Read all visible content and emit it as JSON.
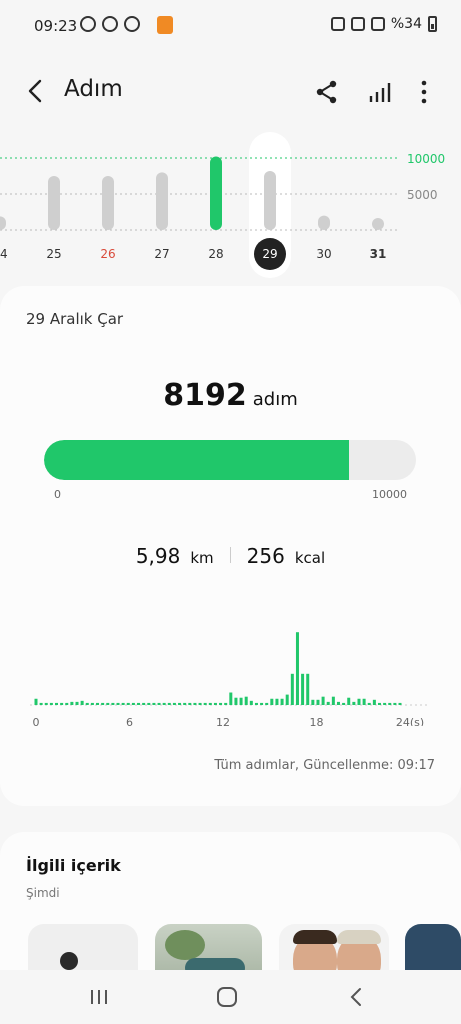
{
  "status": {
    "time": "09:23",
    "battery": "%34",
    "left_icons": [
      "whatsapp-icon",
      "bixby-icon",
      "shazam-icon"
    ],
    "right_icons": [
      "alarm-icon",
      "wifi-icon",
      "signal-icon"
    ]
  },
  "appbar": {
    "title": "Adım"
  },
  "week": {
    "goal_label": "10000",
    "mid_label": "5000",
    "days": [
      {
        "label": "24",
        "value": 1900,
        "color": "normal"
      },
      {
        "label": "25",
        "value": 7500,
        "color": "normal"
      },
      {
        "label": "26",
        "value": 7500,
        "color": "red"
      },
      {
        "label": "27",
        "value": 8000,
        "color": "normal"
      },
      {
        "label": "28",
        "value": 10200,
        "color": "normal"
      },
      {
        "label": "29",
        "value": 8192,
        "color": "selected"
      },
      {
        "label": "30",
        "value": 2000,
        "color": "normal"
      },
      {
        "label": "31",
        "value": 900,
        "color": "bold"
      }
    ]
  },
  "summary": {
    "date": "29 Aralık Çar",
    "steps": "8192",
    "steps_unit": "adım",
    "goal_fraction": 0.8192,
    "progress_min": "0",
    "progress_max": "10000",
    "distance": "5,98",
    "distance_unit": "km",
    "calories": "256",
    "calories_unit": "kcal",
    "updated": "Tüm adımlar, Güncellenme: 09:17"
  },
  "chart_data": {
    "type": "bar",
    "x_ticks": [
      "0",
      "6",
      "12",
      "18",
      "24(s)"
    ],
    "values": [
      0.06,
      0.02,
      0.02,
      0.02,
      0.02,
      0.02,
      0.02,
      0.03,
      0.03,
      0.04,
      0.02,
      0.02,
      0.02,
      0.02,
      0.02,
      0.02,
      0.02,
      0.02,
      0.02,
      0.02,
      0.02,
      0.02,
      0.02,
      0.02,
      0.02,
      0.02,
      0.02,
      0.02,
      0.02,
      0.02,
      0.02,
      0.02,
      0.02,
      0.02,
      0.02,
      0.02,
      0.02,
      0.02,
      0.12,
      0.07,
      0.07,
      0.08,
      0.04,
      0.02,
      0.02,
      0.02,
      0.06,
      0.06,
      0.06,
      0.1,
      0.3,
      0.7,
      0.3,
      0.3,
      0.05,
      0.05,
      0.08,
      0.03,
      0.08,
      0.03,
      0.02,
      0.07,
      0.03,
      0.06,
      0.06,
      0.02,
      0.05,
      0.02,
      0.02,
      0.02,
      0.02,
      0.02
    ]
  },
  "related": {
    "title": "İlgili içerik",
    "subtitle": "Şimdi"
  },
  "colors": {
    "accent": "#20c76a",
    "red": "#d94a3a",
    "selected": "#222222"
  }
}
